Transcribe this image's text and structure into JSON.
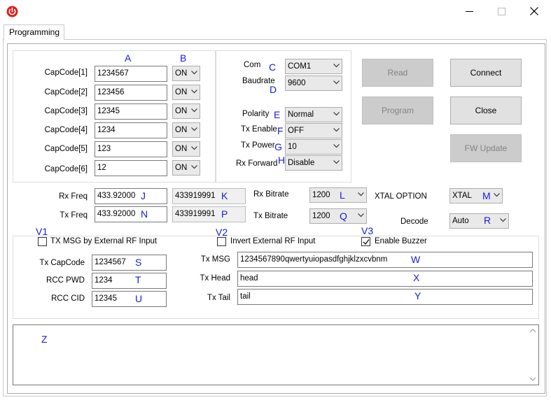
{
  "window": {
    "title": "",
    "tab": "Programming"
  },
  "capcodes": [
    {
      "label": "CapCode[1]",
      "value": "1234567",
      "state": "ON"
    },
    {
      "label": "CapCode[2]",
      "value": "123456",
      "state": "ON"
    },
    {
      "label": "CapCode[3]",
      "value": "12345",
      "state": "ON"
    },
    {
      "label": "CapCode[4]",
      "value": "1234",
      "state": "ON"
    },
    {
      "label": "CapCode[5]",
      "value": "123",
      "state": "ON"
    },
    {
      "label": "CapCode[6]",
      "value": "12",
      "state": "ON"
    }
  ],
  "settings": {
    "com": {
      "label": "Com",
      "value": "COM1"
    },
    "baudrate": {
      "label": "Baudrate",
      "value": "9600"
    },
    "polarity": {
      "label": "Polarity",
      "value": "Normal"
    },
    "tx_enable": {
      "label": "Tx Enable",
      "value": "OFF"
    },
    "tx_power": {
      "label": "Tx Power",
      "value": "10"
    },
    "rx_forward": {
      "label": "Rx Forward",
      "value": "Disable"
    }
  },
  "buttons": {
    "read": "Read",
    "connect": "Connect",
    "program": "Program",
    "close": "Close",
    "fw_update": "FW Update"
  },
  "freq": {
    "rx": {
      "label": "Rx Freq",
      "value": "433.92000",
      "raw": "433919991"
    },
    "tx": {
      "label": "Tx Freq",
      "value": "433.92000",
      "raw": "433919991"
    }
  },
  "bitrate": {
    "rx": {
      "label": "Rx Bitrate",
      "value": "1200"
    },
    "tx": {
      "label": "Tx Bitrate",
      "value": "1200"
    }
  },
  "xtal": {
    "label": "XTAL OPTION",
    "value": "XTAL"
  },
  "decode": {
    "label": "Decode",
    "value": "Auto"
  },
  "options": {
    "tx_msg_external": {
      "label": "TX MSG by External RF Input",
      "checked": false
    },
    "invert_external": {
      "label": "Invert External RF Input",
      "checked": false
    },
    "enable_buzzer": {
      "label": "Enable Buzzer",
      "checked": true
    }
  },
  "tx": {
    "capcode": {
      "label": "Tx CapCode",
      "value": "1234567"
    },
    "rcc_pwd": {
      "label": "RCC PWD",
      "value": "1234"
    },
    "rcc_cid": {
      "label": "RCC CID",
      "value": "12345"
    },
    "msg": {
      "label": "Tx MSG",
      "value": "1234567890qwertyuiopasdfghjklzxcvbnm"
    },
    "head": {
      "label": "Tx Head",
      "value": "head"
    },
    "tail": {
      "label": "Tx Tail",
      "value": "tail"
    }
  },
  "markers": {
    "A": "A",
    "B": "B",
    "C": "C",
    "D": "D",
    "E": "E",
    "F": "F",
    "G": "G",
    "H": "H",
    "J": "J",
    "K": "K",
    "L": "L",
    "M": "M",
    "N": "N",
    "P": "P",
    "Q": "Q",
    "R": "R",
    "S": "S",
    "T": "T",
    "U": "U",
    "V1": "V1",
    "V2": "V2",
    "V3": "V3",
    "W": "W",
    "X": "X",
    "Y": "Y",
    "Z": "Z"
  },
  "log": {
    "text": ""
  },
  "colors": {
    "annotation": "#1a1ad6",
    "disabled_button": "#cccccc",
    "button": "#e1e1e1"
  }
}
